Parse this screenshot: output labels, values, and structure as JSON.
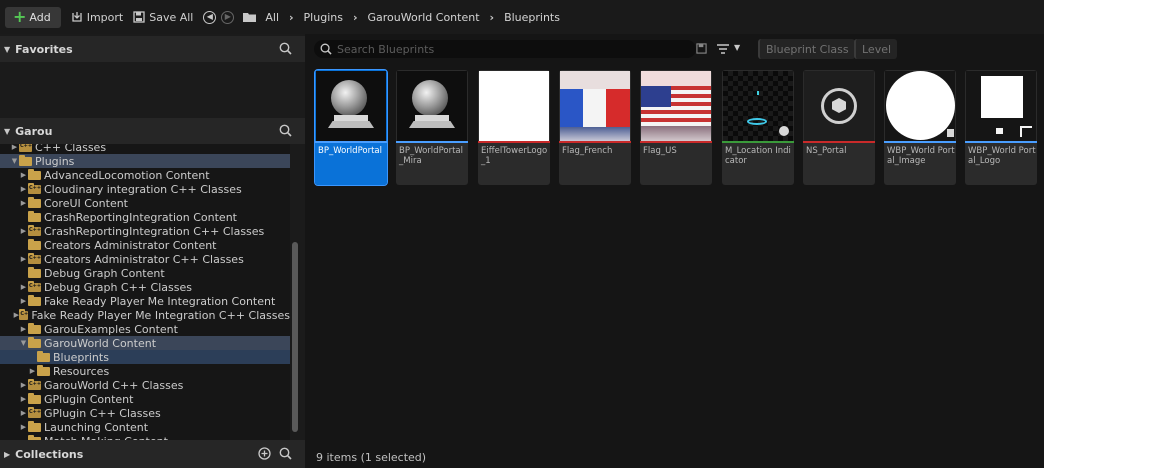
{
  "toolbar": {
    "add_label": "Add",
    "import_label": "Import",
    "save_all_label": "Save All",
    "breadcrumbs": [
      "All",
      "Plugins",
      "GarouWorld Content",
      "Blueprints"
    ]
  },
  "left": {
    "favorites_title": "Favorites",
    "project_title": "Garou",
    "collections_title": "Collections",
    "tree": [
      {
        "label": "C++ Classes",
        "indent": 1,
        "kind": "cpp",
        "state": "collapsed"
      },
      {
        "label": "Plugins",
        "indent": 1,
        "kind": "folder",
        "state": "expanded",
        "selected": true
      },
      {
        "label": "AdvancedLocomotion Content",
        "indent": 2,
        "kind": "folder",
        "state": "collapsed"
      },
      {
        "label": "Cloudinary integration C++ Classes",
        "indent": 2,
        "kind": "cpp",
        "state": "collapsed"
      },
      {
        "label": "CoreUI Content",
        "indent": 2,
        "kind": "folder",
        "state": "collapsed"
      },
      {
        "label": "CrashReportingIntegration Content",
        "indent": 2,
        "kind": "folder",
        "state": "none"
      },
      {
        "label": "CrashReportingIntegration C++ Classes",
        "indent": 2,
        "kind": "cpp",
        "state": "collapsed"
      },
      {
        "label": "Creators Administrator Content",
        "indent": 2,
        "kind": "folder",
        "state": "none"
      },
      {
        "label": "Creators Administrator C++ Classes",
        "indent": 2,
        "kind": "cpp",
        "state": "collapsed"
      },
      {
        "label": "Debug Graph Content",
        "indent": 2,
        "kind": "folder",
        "state": "none"
      },
      {
        "label": "Debug Graph C++ Classes",
        "indent": 2,
        "kind": "cpp",
        "state": "collapsed"
      },
      {
        "label": "Fake Ready Player Me Integration Content",
        "indent": 2,
        "kind": "folder",
        "state": "collapsed"
      },
      {
        "label": "Fake Ready Player Me Integration C++ Classes",
        "indent": 2,
        "kind": "cpp",
        "state": "collapsed"
      },
      {
        "label": "GarouExamples Content",
        "indent": 2,
        "kind": "folder",
        "state": "collapsed"
      },
      {
        "label": "GarouWorld Content",
        "indent": 2,
        "kind": "folder",
        "state": "expanded",
        "selected": true
      },
      {
        "label": "Blueprints",
        "indent": 3,
        "kind": "folder",
        "state": "none",
        "current": true
      },
      {
        "label": "Resources",
        "indent": 3,
        "kind": "folder",
        "state": "collapsed"
      },
      {
        "label": "GarouWorld C++ Classes",
        "indent": 2,
        "kind": "cpp",
        "state": "collapsed"
      },
      {
        "label": "GPlugin Content",
        "indent": 2,
        "kind": "folder",
        "state": "collapsed"
      },
      {
        "label": "GPlugin C++ Classes",
        "indent": 2,
        "kind": "cpp",
        "state": "collapsed"
      },
      {
        "label": "Launching Content",
        "indent": 2,
        "kind": "folder",
        "state": "collapsed"
      },
      {
        "label": "Match Making Content",
        "indent": 2,
        "kind": "folder",
        "state": "none"
      }
    ]
  },
  "right": {
    "search_placeholder": "Search Blueprints",
    "filter_blueprint_class": "Blueprint Class",
    "filter_level": "Level",
    "assets": [
      {
        "name": "BP_WorldPortal",
        "thumb": "sphere",
        "stripe": "#4a9eff",
        "selected": true
      },
      {
        "name": "BP_WorldPortal_Mira",
        "thumb": "sphere",
        "stripe": "#4a9eff"
      },
      {
        "name": "EiffelTowerLogo_1",
        "thumb": "white",
        "stripe": "#c92a2a"
      },
      {
        "name": "Flag_French",
        "thumb": "flag-fr",
        "stripe": "#c92a2a"
      },
      {
        "name": "Flag_US",
        "thumb": "flag-us",
        "stripe": "#c92a2a"
      },
      {
        "name": "M_Location Indicator",
        "thumb": "material",
        "stripe": "#3a9a3a"
      },
      {
        "name": "NS_Portal",
        "thumb": "niagara",
        "stripe": "#c92a2a"
      },
      {
        "name": "WBP_World Portal_Image",
        "thumb": "circle",
        "stripe": "#4a9eff"
      },
      {
        "name": "WBP_World Portal_Logo",
        "thumb": "logo",
        "stripe": "#4a9eff"
      }
    ],
    "status": "9 items (1 selected)"
  },
  "colors": {
    "accent": "#0a72d8",
    "blueprint_stripe": "#4a9eff",
    "texture_stripe": "#c92a2a",
    "material_stripe": "#3a9a3a",
    "folder": "#c9a24a"
  }
}
